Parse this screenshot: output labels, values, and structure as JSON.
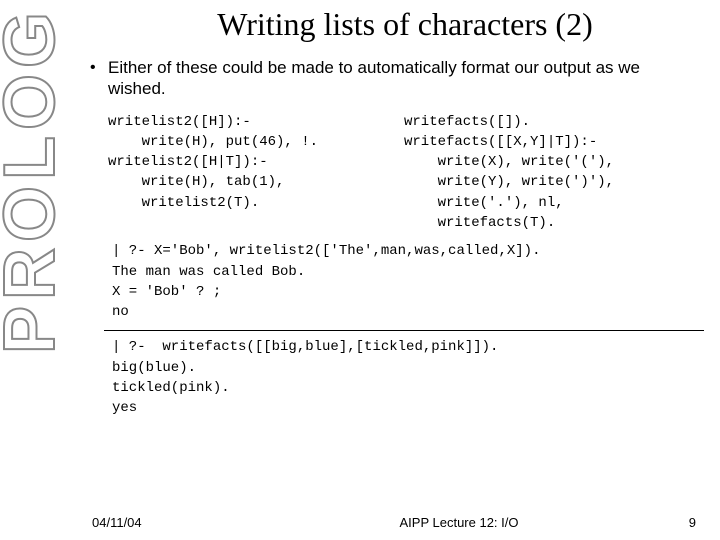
{
  "sidebar": {
    "logo_text": "PROLOG"
  },
  "title": "Writing lists of characters (2)",
  "bullet": {
    "marker": "•",
    "text": "Either of these could be made to automatically format our output as we wished."
  },
  "code": {
    "left": "writelist2([H]):-\n    write(H), put(46), !.\nwritelist2([H|T]):-\n    write(H), tab(1),\n    writelist2(T).",
    "right": "writefacts([]).\nwritefacts([[X,Y]|T]):-\n    write(X), write('('),\n    write(Y), write(')'),\n    write('.'), nl,\n    writefacts(T)."
  },
  "block1": "| ?- X='Bob', writelist2(['The',man,was,called,X]).\nThe man was called Bob.\nX = 'Bob' ? ;\nno",
  "block2": "| ?-  writefacts([[big,blue],[tickled,pink]]).\nbig(blue).\ntickled(pink).\nyes",
  "footer": {
    "date": "04/11/04",
    "lecture": "AIPP Lecture 12: I/O",
    "page": "9"
  }
}
